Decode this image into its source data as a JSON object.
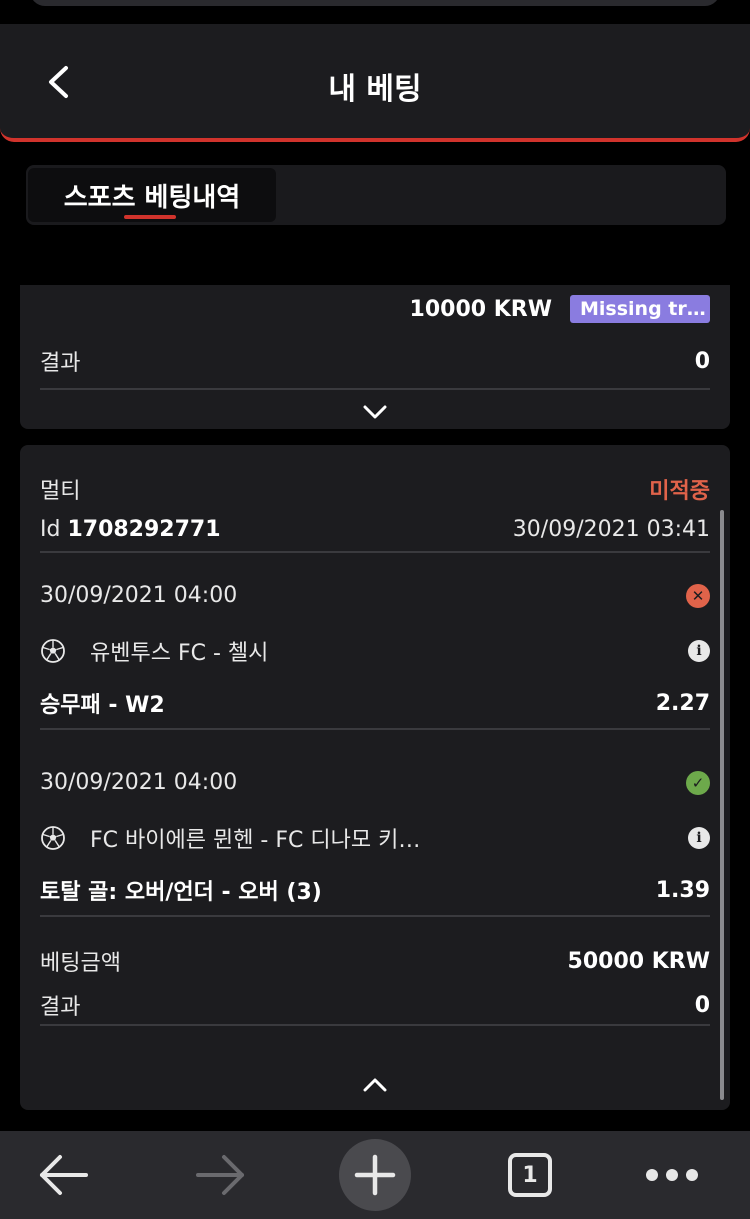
{
  "header": {
    "title": "내 베팅"
  },
  "tabs": [
    {
      "label": "스포츠 베팅내역"
    }
  ],
  "card_prev": {
    "amount_value": "10000 KRW",
    "badge": "Missing tr…",
    "result_label": "결과",
    "result_value": "0"
  },
  "card_multi": {
    "type": "멀티",
    "status": "미적중",
    "id_prefix": "Id",
    "id_value": "1708292771",
    "datetime": "30/09/2021 03:41",
    "selections": [
      {
        "datetime": "30/09/2021 04:00",
        "outcome": "lost",
        "match": "유벤투스 FC - 첼시",
        "market": "승무패 - W2",
        "odds": "2.27"
      },
      {
        "datetime": "30/09/2021 04:00",
        "outcome": "won",
        "match": "FC 바이에른 뮌헨 - FC 디나모 키…",
        "market": "토탈 골: 오버/언더 - 오버 (3)",
        "odds": "1.39"
      }
    ],
    "stake_label": "베팅금액",
    "stake_value": "50000 KRW",
    "result_label": "결과",
    "result_value": "0"
  },
  "bottom_nav": {
    "tab_count": "1"
  },
  "colors": {
    "accent": "#d0332c",
    "lost": "#e0634a",
    "won": "#6da94b",
    "badge": "#8a7ce0"
  }
}
